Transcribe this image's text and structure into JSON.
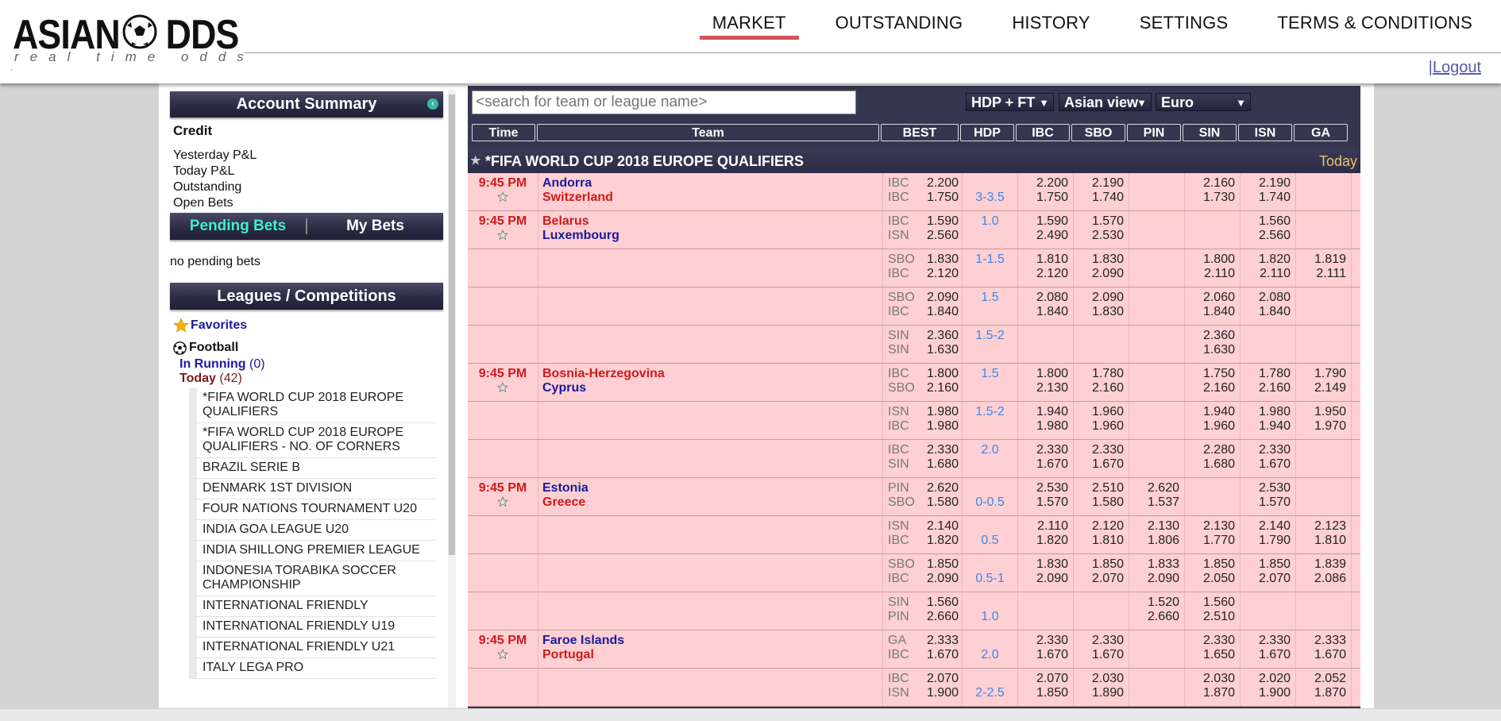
{
  "brand": {
    "logo_text": "ASIAN ODDS",
    "logo_subtitle": "real time odds",
    "logo_dot": "."
  },
  "nav": {
    "items": [
      {
        "label": "MARKET",
        "active": true
      },
      {
        "label": "OUTSTANDING",
        "active": false
      },
      {
        "label": "HISTORY",
        "active": false
      },
      {
        "label": "SETTINGS",
        "active": false
      },
      {
        "label": "TERMS & CONDITIONS",
        "active": false
      }
    ],
    "logout_sep": "|",
    "logout": "Logout"
  },
  "account": {
    "title": "Account Summary",
    "credit": "Credit",
    "lines": [
      "Yesterday P&L",
      "Today P&L",
      "Outstanding",
      "Open Bets"
    ]
  },
  "bets": {
    "pending_tab": "Pending Bets",
    "my_tab": "My Bets",
    "empty": "no pending bets"
  },
  "leagues_panel": {
    "title": "Leagues / Competitions",
    "favorites": "Favorites",
    "sport": "Football",
    "in_running_label": "In Running",
    "in_running_count": "(0)",
    "today_label": "Today",
    "today_count": "(42)",
    "items": [
      "*FIFA WORLD CUP 2018 EUROPE QUALIFIERS",
      "*FIFA WORLD CUP 2018 EUROPE QUALIFIERS - NO. OF CORNERS",
      "BRAZIL SERIE B",
      "DENMARK 1ST DIVISION",
      "FOUR NATIONS TOURNAMENT U20",
      "INDIA GOA LEAGUE U20",
      "INDIA SHILLONG PREMIER LEAGUE",
      "INDONESIA TORABIKA SOCCER CHAMPIONSHIP",
      "INTERNATIONAL FRIENDLY",
      "INTERNATIONAL FRIENDLY U19",
      "INTERNATIONAL FRIENDLY U21",
      "ITALY LEGA PRO"
    ]
  },
  "market": {
    "search_placeholder": "<search for team or league name>",
    "market_select": "HDP + FT",
    "view_select": "Asian view",
    "odds_select": "Euro",
    "columns": [
      "Time",
      "Team",
      "BEST",
      "HDP",
      "IBC",
      "SBO",
      "PIN",
      "SIN",
      "ISN",
      "GA"
    ],
    "league": {
      "name": "*FIFA WORLD CUP 2018 EUROPE QUALIFIERS",
      "when": "Today"
    },
    "rows": [
      {
        "time": "9:45 PM",
        "star": true,
        "home": "Andorra",
        "away": "Switzerland",
        "home_color": "blue",
        "away_color": "red",
        "best": [
          [
            "IBC",
            "2.200"
          ],
          [
            "IBC",
            "1.750"
          ]
        ],
        "hdp": "3-3.5",
        "books": [
          [
            "2.200",
            "1.750"
          ],
          [
            "2.190",
            "1.740"
          ],
          [
            "",
            ""
          ],
          [
            "2.160",
            "1.730"
          ],
          [
            "2.190",
            "1.740"
          ],
          [
            "",
            ""
          ]
        ]
      },
      {
        "time": "9:45 PM",
        "star": true,
        "home": "Belarus",
        "away": "Luxembourg",
        "home_color": "red",
        "away_color": "blue",
        "best": [
          [
            "IBC",
            "1.590"
          ],
          [
            "ISN",
            "2.560"
          ]
        ],
        "hdp": "1.0",
        "hdp_top": true,
        "books": [
          [
            "1.590",
            "2.490"
          ],
          [
            "1.570",
            "2.530"
          ],
          [
            "",
            ""
          ],
          [
            "",
            ""
          ],
          [
            "1.560",
            "2.560"
          ],
          [
            "",
            ""
          ]
        ]
      },
      {
        "time": "",
        "star": false,
        "home": "",
        "away": "",
        "best": [
          [
            "SBO",
            "1.830"
          ],
          [
            "IBC",
            "2.120"
          ]
        ],
        "hdp": "1-1.5",
        "hdp_top": true,
        "books": [
          [
            "1.810",
            "2.120"
          ],
          [
            "1.830",
            "2.090"
          ],
          [
            "",
            ""
          ],
          [
            "1.800",
            "2.110"
          ],
          [
            "1.820",
            "2.110"
          ],
          [
            "1.819",
            "2.111"
          ]
        ]
      },
      {
        "time": "",
        "star": false,
        "home": "",
        "away": "",
        "best": [
          [
            "SBO",
            "2.090"
          ],
          [
            "IBC",
            "1.840"
          ]
        ],
        "hdp": "1.5",
        "hdp_top": true,
        "books": [
          [
            "2.080",
            "1.840"
          ],
          [
            "2.090",
            "1.830"
          ],
          [
            "",
            ""
          ],
          [
            "2.060",
            "1.840"
          ],
          [
            "2.080",
            "1.840"
          ],
          [
            "",
            ""
          ]
        ]
      },
      {
        "time": "",
        "star": false,
        "home": "",
        "away": "",
        "best": [
          [
            "SIN",
            "2.360"
          ],
          [
            "SIN",
            "1.630"
          ]
        ],
        "hdp": "1.5-2",
        "hdp_top": true,
        "books": [
          [
            "",
            ""
          ],
          [
            "",
            ""
          ],
          [
            "",
            ""
          ],
          [
            "2.360",
            "1.630"
          ],
          [
            "",
            ""
          ],
          [
            "",
            ""
          ]
        ]
      },
      {
        "time": "9:45 PM",
        "star": true,
        "home": "Bosnia-Herzegovina",
        "away": "Cyprus",
        "home_color": "red",
        "away_color": "blue",
        "best": [
          [
            "IBC",
            "1.800"
          ],
          [
            "SBO",
            "2.160"
          ]
        ],
        "hdp": "1.5",
        "hdp_top": true,
        "books": [
          [
            "1.800",
            "2.130"
          ],
          [
            "1.780",
            "2.160"
          ],
          [
            "",
            ""
          ],
          [
            "1.750",
            "2.160"
          ],
          [
            "1.780",
            "2.160"
          ],
          [
            "1.790",
            "2.149"
          ]
        ]
      },
      {
        "time": "",
        "star": false,
        "home": "",
        "away": "",
        "best": [
          [
            "ISN",
            "1.980"
          ],
          [
            "IBC",
            "1.980"
          ]
        ],
        "hdp": "1.5-2",
        "hdp_top": true,
        "books": [
          [
            "1.940",
            "1.980"
          ],
          [
            "1.960",
            "1.960"
          ],
          [
            "",
            ""
          ],
          [
            "1.940",
            "1.960"
          ],
          [
            "1.980",
            "1.940"
          ],
          [
            "1.950",
            "1.970"
          ]
        ]
      },
      {
        "time": "",
        "star": false,
        "home": "",
        "away": "",
        "best": [
          [
            "IBC",
            "2.330"
          ],
          [
            "SIN",
            "1.680"
          ]
        ],
        "hdp": "2.0",
        "hdp_top": true,
        "books": [
          [
            "2.330",
            "1.670"
          ],
          [
            "2.330",
            "1.670"
          ],
          [
            "",
            ""
          ],
          [
            "2.280",
            "1.680"
          ],
          [
            "2.330",
            "1.670"
          ],
          [
            "",
            ""
          ]
        ]
      },
      {
        "time": "9:45 PM",
        "star": true,
        "home": "Estonia",
        "away": "Greece",
        "home_color": "blue",
        "away_color": "red",
        "best": [
          [
            "PIN",
            "2.620"
          ],
          [
            "SBO",
            "1.580"
          ]
        ],
        "hdp": "0-0.5",
        "books": [
          [
            "2.530",
            "1.570"
          ],
          [
            "2.510",
            "1.580"
          ],
          [
            "2.620",
            "1.537"
          ],
          [
            "",
            ""
          ],
          [
            "2.530",
            "1.570"
          ],
          [
            "",
            ""
          ]
        ]
      },
      {
        "time": "",
        "star": false,
        "home": "",
        "away": "",
        "best": [
          [
            "ISN",
            "2.140"
          ],
          [
            "IBC",
            "1.820"
          ]
        ],
        "hdp": "0.5",
        "books": [
          [
            "2.110",
            "1.820"
          ],
          [
            "2.120",
            "1.810"
          ],
          [
            "2.130",
            "1.806"
          ],
          [
            "2.130",
            "1.770"
          ],
          [
            "2.140",
            "1.790"
          ],
          [
            "2.123",
            "1.810"
          ]
        ]
      },
      {
        "time": "",
        "star": false,
        "home": "",
        "away": "",
        "best": [
          [
            "SBO",
            "1.850"
          ],
          [
            "IBC",
            "2.090"
          ]
        ],
        "hdp": "0.5-1",
        "books": [
          [
            "1.830",
            "2.090"
          ],
          [
            "1.850",
            "2.070"
          ],
          [
            "1.833",
            "2.090"
          ],
          [
            "1.850",
            "2.050"
          ],
          [
            "1.850",
            "2.070"
          ],
          [
            "1.839",
            "2.086"
          ]
        ]
      },
      {
        "time": "",
        "star": false,
        "home": "",
        "away": "",
        "best": [
          [
            "SIN",
            "1.560"
          ],
          [
            "PIN",
            "2.660"
          ]
        ],
        "hdp": "1.0",
        "books": [
          [
            "",
            ""
          ],
          [
            "",
            ""
          ],
          [
            "1.520",
            "2.660"
          ],
          [
            "1.560",
            "2.510"
          ],
          [
            "",
            ""
          ],
          [
            "",
            ""
          ]
        ]
      },
      {
        "time": "9:45 PM",
        "star": true,
        "home": "Faroe Islands",
        "away": "Portugal",
        "home_color": "blue",
        "away_color": "red",
        "best": [
          [
            "GA",
            "2.333"
          ],
          [
            "IBC",
            "1.670"
          ]
        ],
        "hdp": "2.0",
        "books": [
          [
            "2.330",
            "1.670"
          ],
          [
            "2.330",
            "1.670"
          ],
          [
            "",
            ""
          ],
          [
            "2.330",
            "1.650"
          ],
          [
            "2.330",
            "1.670"
          ],
          [
            "2.333",
            "1.670"
          ]
        ]
      },
      {
        "time": "",
        "star": false,
        "home": "",
        "away": "",
        "best": [
          [
            "IBC",
            "2.070"
          ],
          [
            "ISN",
            "1.900"
          ]
        ],
        "hdp": "2-2.5",
        "books": [
          [
            "2.070",
            "1.850"
          ],
          [
            "2.030",
            "1.890"
          ],
          [
            "",
            ""
          ],
          [
            "2.030",
            "1.870"
          ],
          [
            "2.020",
            "1.900"
          ],
          [
            "2.052",
            "1.870"
          ]
        ]
      }
    ]
  },
  "colors": {
    "row_bg": "#fed0d3",
    "header_dark": "#2b2b45",
    "accent_red": "#d01a1a",
    "link_blue": "#1a1a9c",
    "hdp_blue": "#3c87e6",
    "today_gold": "#e7c56a",
    "active_underline": "#d0565a",
    "pending_teal": "#3ef0c9"
  }
}
